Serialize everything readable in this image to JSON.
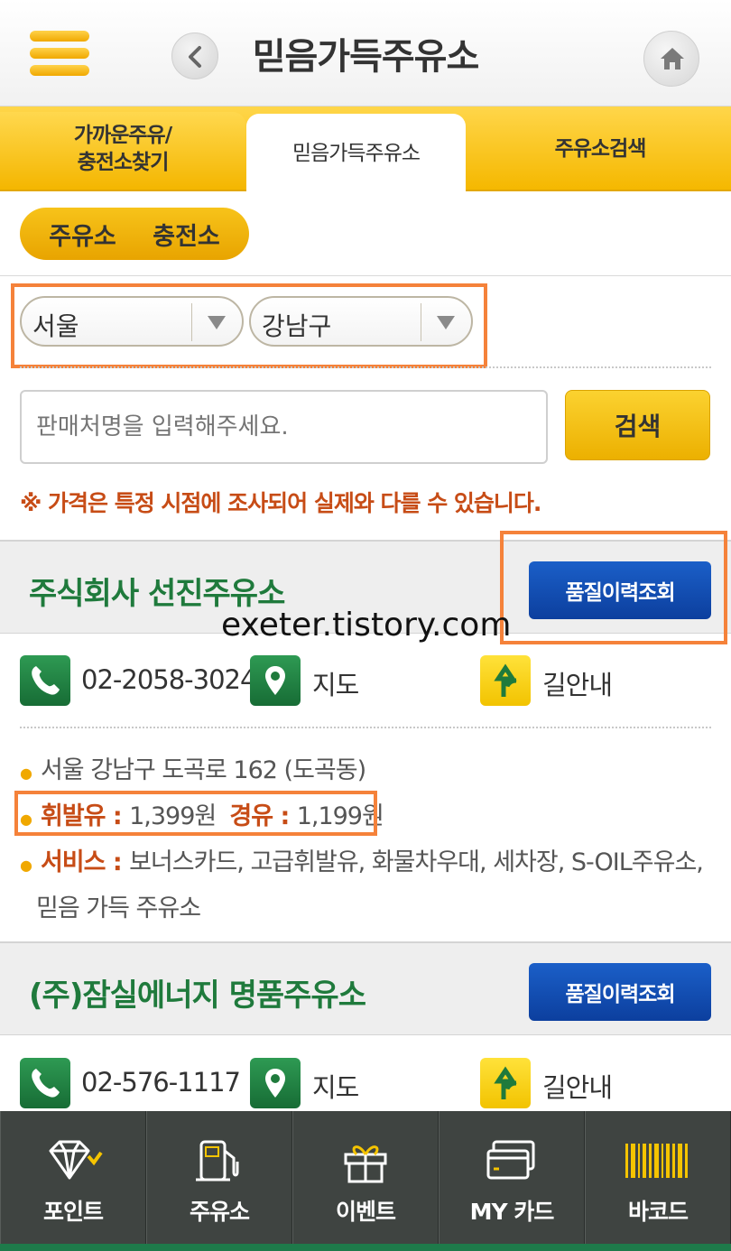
{
  "header": {
    "title": "믿음가득주유소"
  },
  "tabs": {
    "near_line1": "가까운주유/",
    "near_line2": "충전소찾기",
    "trust": "믿음가득주유소",
    "search": "주유소검색"
  },
  "type_toggle": {
    "gas": "주유소",
    "charge": "충전소"
  },
  "region": {
    "city": "서울",
    "district": "강남구"
  },
  "search": {
    "placeholder": "판매처명을 입력해주세요.",
    "button": "검색"
  },
  "notice": "※ 가격은 특정 시점에 조사되어 실제와 다를 수 있습니다.",
  "watermark": "exeter.tistory.com",
  "stations": [
    {
      "name": "주식회사 선진주유소",
      "quality_button": "품질이력조회",
      "phone": "02-2058-3024",
      "map_label": "지도",
      "route_label": "길안내",
      "address": "서울 강남구 도곡로 162 (도곡동)",
      "gasoline_label": "휘발유 : ",
      "gasoline_price": "1,399원",
      "diesel_label": "경유 : ",
      "diesel_price": "1,199원",
      "service_label": "서비스 : ",
      "services_line1": "보너스카드, 고급휘발유, 화물차우대, 세차장, S-OIL주유소,",
      "services_line2": "믿음 가득 주유소"
    },
    {
      "name": "(주)잠실에너지 명품주유소",
      "quality_button": "품질이력조회",
      "phone": "02-576-1117",
      "map_label": "지도",
      "route_label": "길안내"
    }
  ],
  "bottom_nav": [
    {
      "label": "포인트",
      "icon": "diamond-icon"
    },
    {
      "label": "주유소",
      "icon": "fuel-pump-icon"
    },
    {
      "label": "이벤트",
      "icon": "gift-icon"
    },
    {
      "label": "MY 카드",
      "icon": "card-icon"
    },
    {
      "label": "바코드",
      "icon": "barcode-icon"
    }
  ],
  "colors": {
    "accent": "#f5b800",
    "green": "#1f7a3c",
    "notice": "#c74c16",
    "highlight": "#f5823a",
    "blue": "#0c3f9e"
  }
}
